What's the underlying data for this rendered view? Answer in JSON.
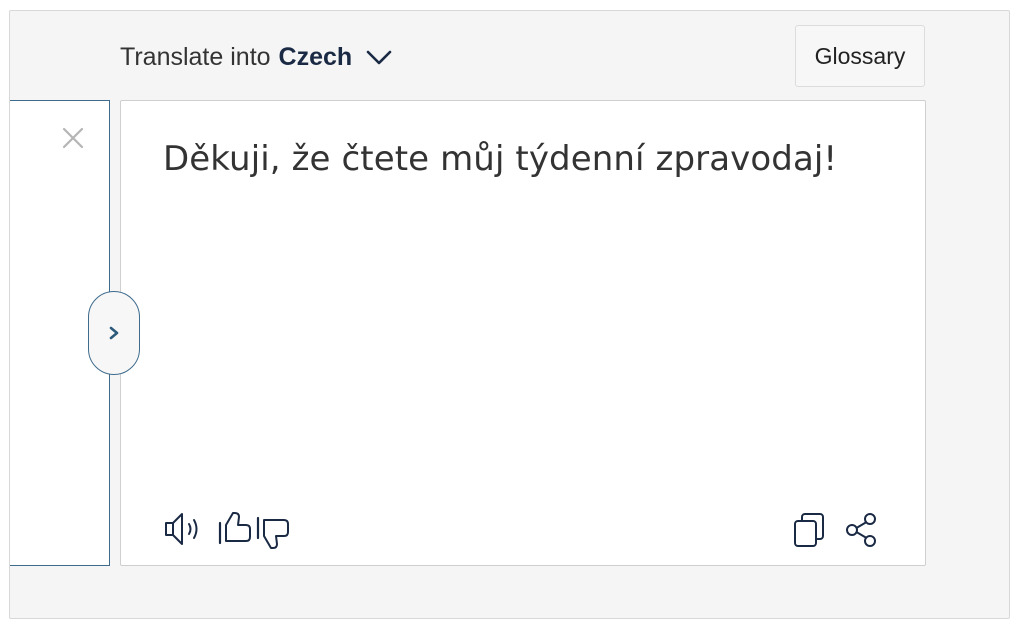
{
  "header": {
    "translate_prefix": "Translate into",
    "target_language": "Czech",
    "language_dropdown_icon": "chevron-down-icon",
    "glossary_label": "Glossary"
  },
  "source_panel": {
    "close_icon": "close-icon"
  },
  "target_panel": {
    "translation": "Děkuji, že čtete můj týdenní zpravodaj!",
    "toolbar_icons": [
      "speaker-icon",
      "thumbs-up-icon",
      "thumbs-down-icon",
      "copy-icon",
      "share-icon"
    ]
  },
  "panel_toggle": {
    "icon": "chevron-right-icon"
  },
  "colors": {
    "accent_border": "#3f6b8c",
    "language_text": "#1b2a44",
    "icon_stroke": "#1b2a44",
    "background": "#f5f5f5"
  }
}
